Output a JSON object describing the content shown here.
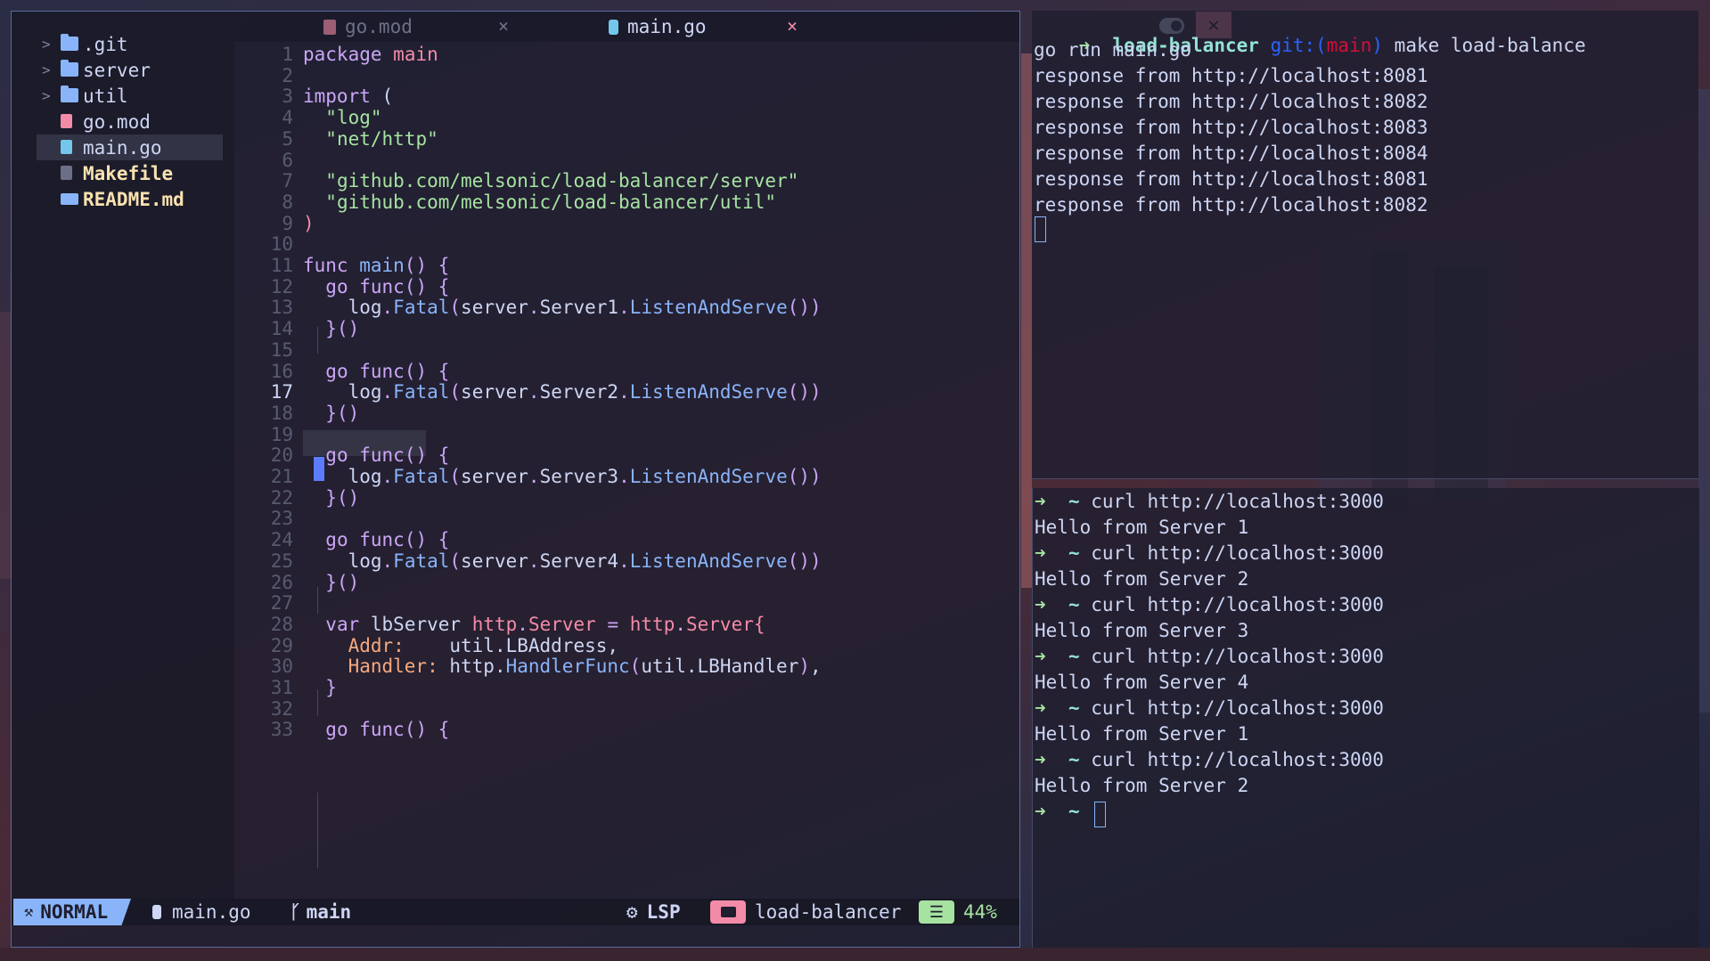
{
  "editor": {
    "tree": [
      {
        "name": ".git",
        "type": "folder",
        "chevron": ">"
      },
      {
        "name": "server",
        "type": "folder",
        "chevron": ">"
      },
      {
        "name": "util",
        "type": "folder",
        "chevron": ">"
      },
      {
        "name": "go.mod",
        "type": "file"
      },
      {
        "name": "main.go",
        "type": "file",
        "selected": true
      },
      {
        "name": "Makefile",
        "type": "file"
      },
      {
        "name": "README.md",
        "type": "file"
      }
    ],
    "tabs": [
      {
        "label": "go.mod",
        "close": "×",
        "active": false
      },
      {
        "label": "main.go",
        "close": "×",
        "active": true
      }
    ],
    "window_close": "✕",
    "line_numbers": [
      "1",
      "2",
      "3",
      "4",
      "5",
      "6",
      "7",
      "8",
      "9",
      "10",
      "11",
      "12",
      "13",
      "14",
      "15",
      "16",
      "17",
      "18",
      "19",
      "20",
      "21",
      "22",
      "23",
      "24",
      "25",
      "26",
      "27",
      "28",
      "29",
      "30",
      "31",
      "32",
      "33"
    ],
    "current_line": "17",
    "code": [
      [
        [
          "kw",
          "package"
        ],
        [
          "",
          "·"
        ],
        [
          "ty",
          "main"
        ]
      ],
      [],
      [
        [
          "kw",
          "import"
        ],
        [
          "",
          "·"
        ],
        [
          "",
          "("
        ]
      ],
      [
        [
          "",
          "  "
        ],
        [
          "str",
          "\"log\""
        ]
      ],
      [
        [
          "",
          "  "
        ],
        [
          "str",
          "\"net/http\""
        ]
      ],
      [],
      [
        [
          "",
          "  "
        ],
        [
          "str",
          "\"github.com/melsonic/load-balancer/server\""
        ]
      ],
      [
        [
          "",
          "  "
        ],
        [
          "str",
          "\"github.com/melsonic/load-balancer/util\""
        ]
      ],
      [
        [
          "ty",
          ")"
        ]
      ],
      [],
      [
        [
          "kw",
          "func"
        ],
        [
          "",
          "·"
        ],
        [
          "fn",
          "main"
        ],
        [
          "kw",
          "() {"
        ]
      ],
      [
        [
          "",
          "  "
        ],
        [
          "kw",
          "go"
        ],
        [
          "",
          "·"
        ],
        [
          "kw",
          "func() {"
        ]
      ],
      [
        [
          "",
          "    "
        ],
        [
          "",
          "log"
        ],
        [
          "kw",
          "."
        ],
        [
          "fn",
          "Fatal"
        ],
        [
          "kw",
          "("
        ],
        [
          "",
          "server"
        ],
        [
          "kw",
          "."
        ],
        [
          "",
          "Server1"
        ],
        [
          "kw",
          "."
        ],
        [
          "fn",
          "ListenAndServe"
        ],
        [
          "kw",
          "())"
        ]
      ],
      [
        [
          "",
          "  "
        ],
        [
          "kw",
          "}()"
        ]
      ],
      [],
      [
        [
          "",
          "  "
        ],
        [
          "kw",
          "go"
        ],
        [
          "",
          "·"
        ],
        [
          "kw",
          "func() {"
        ]
      ],
      [
        [
          "",
          "    "
        ],
        [
          "",
          "log"
        ],
        [
          "kw",
          "."
        ],
        [
          "fn",
          "Fatal"
        ],
        [
          "kw",
          "("
        ],
        [
          "",
          "server"
        ],
        [
          "kw",
          "."
        ],
        [
          "",
          "Server2"
        ],
        [
          "kw",
          "."
        ],
        [
          "fn",
          "ListenAndServe"
        ],
        [
          "kw",
          "())"
        ]
      ],
      [
        [
          "",
          "  "
        ],
        [
          "kw",
          "}()"
        ]
      ],
      [],
      [
        [
          "",
          "  "
        ],
        [
          "kw",
          "go"
        ],
        [
          "",
          "·"
        ],
        [
          "kw",
          "func() {"
        ]
      ],
      [
        [
          "",
          "    "
        ],
        [
          "",
          "log"
        ],
        [
          "kw",
          "."
        ],
        [
          "fn",
          "Fatal"
        ],
        [
          "kw",
          "("
        ],
        [
          "",
          "server"
        ],
        [
          "kw",
          "."
        ],
        [
          "",
          "Server3"
        ],
        [
          "kw",
          "."
        ],
        [
          "fn",
          "ListenAndServe"
        ],
        [
          "kw",
          "())"
        ]
      ],
      [
        [
          "",
          "  "
        ],
        [
          "kw",
          "}()"
        ]
      ],
      [],
      [
        [
          "",
          "  "
        ],
        [
          "kw",
          "go"
        ],
        [
          "",
          "·"
        ],
        [
          "kw",
          "func() {"
        ]
      ],
      [
        [
          "",
          "    "
        ],
        [
          "",
          "log"
        ],
        [
          "kw",
          "."
        ],
        [
          "fn",
          "Fatal"
        ],
        [
          "kw",
          "("
        ],
        [
          "",
          "server"
        ],
        [
          "kw",
          "."
        ],
        [
          "",
          "Server4"
        ],
        [
          "kw",
          "."
        ],
        [
          "fn",
          "ListenAndServe"
        ],
        [
          "kw",
          "())"
        ]
      ],
      [
        [
          "",
          "  "
        ],
        [
          "kw",
          "}()"
        ]
      ],
      [],
      [
        [
          "",
          "  "
        ],
        [
          "kw",
          "var"
        ],
        [
          "",
          "·"
        ],
        [
          "",
          "lbServer"
        ],
        [
          "",
          "·"
        ],
        [
          "ty",
          "http"
        ],
        [
          "kw",
          "."
        ],
        [
          "ty",
          "Server"
        ],
        [
          "",
          "·"
        ],
        [
          "kw",
          "="
        ],
        [
          "",
          "·"
        ],
        [
          "ty",
          "http"
        ],
        [
          "kw",
          "."
        ],
        [
          "ty",
          "Server{"
        ]
      ],
      [
        [
          "",
          "    "
        ],
        [
          "fld",
          "Addr:"
        ],
        [
          "",
          "    util."
        ],
        [
          "",
          "LBAddress,"
        ]
      ],
      [
        [
          "",
          "    "
        ],
        [
          "fld",
          "Handler:"
        ],
        [
          "",
          ""
        ],
        [
          "",
          ""
        ],
        [
          "",
          "·http."
        ],
        [
          "fn",
          "HandlerFunc"
        ],
        [
          "kw",
          "("
        ],
        [
          "",
          "util.LBHandler"
        ],
        [
          "kw",
          ")"
        ],
        [
          "",
          ","
        ]
      ],
      [
        [
          "",
          "  "
        ],
        [
          "kw",
          "}"
        ]
      ],
      [],
      [
        [
          "",
          "  "
        ],
        [
          "kw",
          "go"
        ],
        [
          "",
          "·"
        ],
        [
          "kw",
          "func() {"
        ]
      ]
    ],
    "status": {
      "mode": "NORMAL",
      "file": "main.go",
      "branch": "main",
      "lsp": "LSP",
      "project": "load-balancer",
      "percent": "44%"
    }
  },
  "term_top": {
    "prompt_arrow": "➜",
    "dir": "load-balancer",
    "git_label": "git:(",
    "git_branch": "main",
    "git_close": ")",
    "command": "make load-balance",
    "output": [
      "go run main.go",
      "response from http://localhost:8081",
      "response from http://localhost:8082",
      "response from http://localhost:8083",
      "response from http://localhost:8084",
      "response from http://localhost:8081",
      "response from http://localhost:8082"
    ]
  },
  "term_bottom": {
    "arrow": "➜",
    "home": "~",
    "entries": [
      {
        "cmd": "curl http://localhost:3000",
        "out": "Hello from Server 1"
      },
      {
        "cmd": "curl http://localhost:3000",
        "out": "Hello from Server 2"
      },
      {
        "cmd": "curl http://localhost:3000",
        "out": "Hello from Server 3"
      },
      {
        "cmd": "curl http://localhost:3000",
        "out": "Hello from Server 4"
      },
      {
        "cmd": "curl http://localhost:3000",
        "out": "Hello from Server 1"
      },
      {
        "cmd": "curl http://localhost:3000",
        "out": "Hello from Server 2"
      }
    ]
  },
  "colors": {
    "accent": "#89b4fa",
    "close": "#f38ba8",
    "prompt": "#a6e3a1"
  }
}
